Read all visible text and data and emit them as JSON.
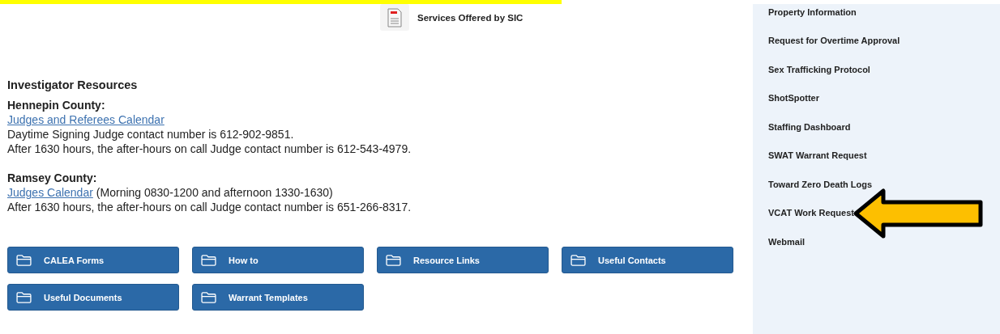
{
  "top_file": {
    "kind": "pdf",
    "label": "Services Offered by SIC"
  },
  "investigator_resources": {
    "title": "Investigator Resources",
    "sections": [
      {
        "heading": "Hennepin County:",
        "link": "Judges and Referees Calendar",
        "lines": [
          "Daytime Signing Judge contact number is 612-902-9851.",
          "After 1630 hours, the after-hours on call Judge contact number is 612-543-4979."
        ]
      },
      {
        "heading": "Ramsey County:",
        "link": "Judges Calendar",
        "link_note": "(Morning 0830-1200 and afternoon 1330-1630)",
        "lines": [
          "After 1630 hours, the after-hours on call Judge contact number is 651-266-8317."
        ]
      }
    ]
  },
  "folders": [
    "CALEA Forms",
    "How to",
    "Resource Links",
    "Useful Contacts",
    "Useful Documents",
    "Warrant Templates"
  ],
  "sidebar": {
    "items": [
      {
        "label": "Property Information",
        "pointed_at": false
      },
      {
        "label": "Request for Overtime Approval",
        "pointed_at": false
      },
      {
        "label": "Sex Trafficking Protocol",
        "pointed_at": false
      },
      {
        "label": "ShotSpotter",
        "pointed_at": false
      },
      {
        "label": "Staffing Dashboard",
        "pointed_at": false
      },
      {
        "label": "SWAT Warrant Request",
        "pointed_at": false
      },
      {
        "label": "Toward Zero Death Logs",
        "pointed_at": false
      },
      {
        "label": "VCAT Work Request",
        "pointed_at": true
      },
      {
        "label": "Webmail",
        "pointed_at": false
      }
    ]
  }
}
